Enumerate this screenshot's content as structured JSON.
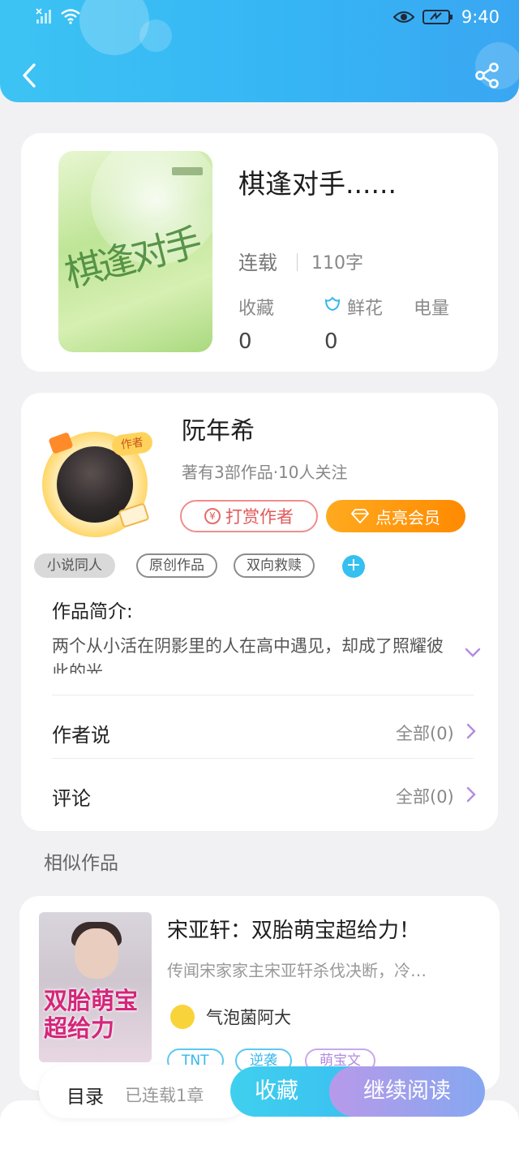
{
  "status_bar": {
    "time": "9:40"
  },
  "book": {
    "title": "棋逢对手......",
    "status": "连载",
    "word_count": "110字",
    "stats": [
      {
        "label": "收藏",
        "value": "0"
      },
      {
        "label": "鲜花",
        "value": "0"
      },
      {
        "label": "电量",
        "value": ""
      }
    ]
  },
  "author": {
    "name": "阮年希",
    "meta": "著有3部作品·10人关注",
    "badge": "作者",
    "tip_label": "打赏作者",
    "vip_label": "点亮会员"
  },
  "tags": [
    "小说同人",
    "原创作品",
    "双向救赎"
  ],
  "intro": {
    "title": "作品简介:",
    "text": "两个从小活在阴影里的人在高中遇见，却成了照耀彼此的光"
  },
  "rows": [
    {
      "label": "作者说",
      "all": "全部(0)"
    },
    {
      "label": "评论",
      "all": "全部(0)"
    }
  ],
  "similar": {
    "section_title": "相似作品",
    "title": "宋亚轩：双胎萌宝超给力！",
    "desc": "传闻宋家家主宋亚轩杀伐决断，冷…",
    "author": "气泡菌阿大",
    "tags": [
      "TNT",
      "逆袭",
      "萌宝文"
    ]
  },
  "bottom": {
    "catalog": "目录",
    "chapters": "已连载1章",
    "collect": "收藏",
    "read": "继续阅读"
  },
  "colors": {
    "header_blue": "#36b4f4",
    "accent_blue": "#35c0ef",
    "vip_orange": "#ff8a00",
    "tip_red": "#e25a5a",
    "chevron_purple": "#b28be0"
  },
  "icons": [
    "back-arrow-icon",
    "share-icon",
    "flower-icon",
    "yen-icon",
    "diamond-icon",
    "plus-icon",
    "chevron-down-icon",
    "chevron-right-icon"
  ]
}
